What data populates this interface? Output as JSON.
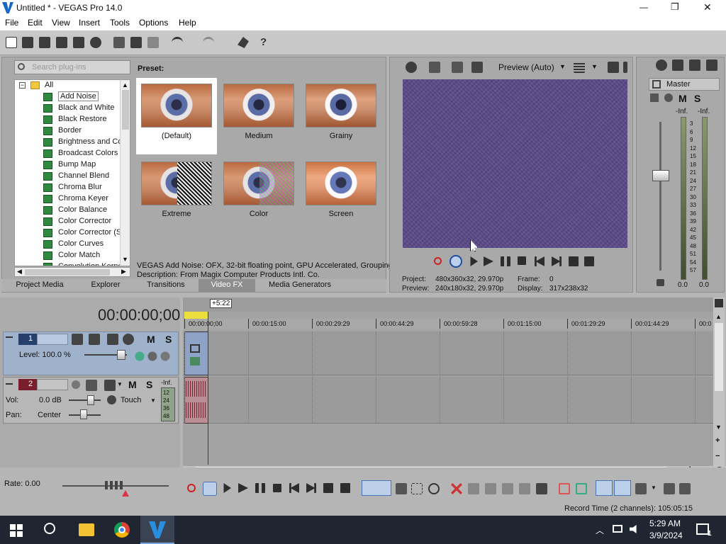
{
  "window": {
    "title": "Untitled * - VEGAS Pro 14.0",
    "minimize": "—",
    "maximize": "❐",
    "close": "✕"
  },
  "menu": [
    "File",
    "Edit",
    "View",
    "Insert",
    "Tools",
    "Options",
    "Help"
  ],
  "plugins": {
    "search_placeholder": "Search plug-ins",
    "root": "All",
    "items": [
      "Add Noise",
      "Black and White",
      "Black Restore",
      "Border",
      "Brightness and Co",
      "Broadcast Colors",
      "Bump Map",
      "Channel Blend",
      "Chroma Blur",
      "Chroma Keyer",
      "Color Balance",
      "Color Corrector",
      "Color Corrector (S",
      "Color Curves",
      "Color Match",
      "Convolution Kerne"
    ],
    "selected": "Add Noise",
    "preset_label": "Preset:",
    "presets": [
      "(Default)",
      "Medium",
      "Grainy",
      "Extreme",
      "Color",
      "Screen"
    ],
    "desc_line1": "VEGAS Add Noise: OFX, 32-bit floating point, GPU Accelerated, Grouping",
    "desc_line2": "Description: From Magix Computer Products Intl. Co."
  },
  "tabs": [
    "Project Media",
    "Explorer",
    "Transitions",
    "Video FX",
    "Media Generators"
  ],
  "active_tab": "Video FX",
  "preview": {
    "mode": "Preview (Auto)",
    "project_label": "Project:",
    "project_value": "480x360x32, 29.970p",
    "frame_label": "Frame:",
    "frame_value": "0",
    "preview_label": "Preview:",
    "preview_value": "240x180x32, 29.970p",
    "display_label": "Display:",
    "display_value": "317x238x32"
  },
  "master": {
    "label": "Master",
    "m": "M",
    "s": "S",
    "inf_l": "-Inf.",
    "inf_r": "-Inf.",
    "scale": [
      "3",
      "6",
      "9",
      "12",
      "15",
      "18",
      "21",
      "24",
      "27",
      "30",
      "33",
      "36",
      "39",
      "42",
      "45",
      "48",
      "51",
      "54",
      "57"
    ],
    "bottom_l": "0.0",
    "bottom_r": "0.0"
  },
  "timecode": "00:00:00;00",
  "ruler": [
    "00:00:00;00",
    "00:00:15:00",
    "00:00:29:29",
    "00:00:44:29",
    "00:00:59:28",
    "00:01:15:00",
    "00:01:29:29",
    "00:01:44:29",
    "00:0"
  ],
  "marker": "+5:22",
  "track1": {
    "num": "1",
    "level_label": "Level: 100.0 %",
    "m": "M",
    "s": "S"
  },
  "track2": {
    "num": "2",
    "vol_label": "Vol:",
    "vol_value": "0.0 dB",
    "pan_label": "Pan:",
    "pan_value": "Center",
    "touch": "Touch",
    "m": "M",
    "s": "S",
    "meter_top": "-Inf.",
    "meter_marks": [
      "12",
      "24",
      "36",
      "48"
    ]
  },
  "rate": "Rate: 0.00",
  "record_time": "Record Time (2 channels): 105:05:15",
  "clock": {
    "time": "5:29 AM",
    "date": "3/9/2024"
  },
  "notification_count": "1",
  "colors": {
    "video_bg": "#5b4a8a",
    "track1": "#9fb2cc",
    "taskbar": "#1f2632",
    "accent": "#2f6fd0"
  }
}
